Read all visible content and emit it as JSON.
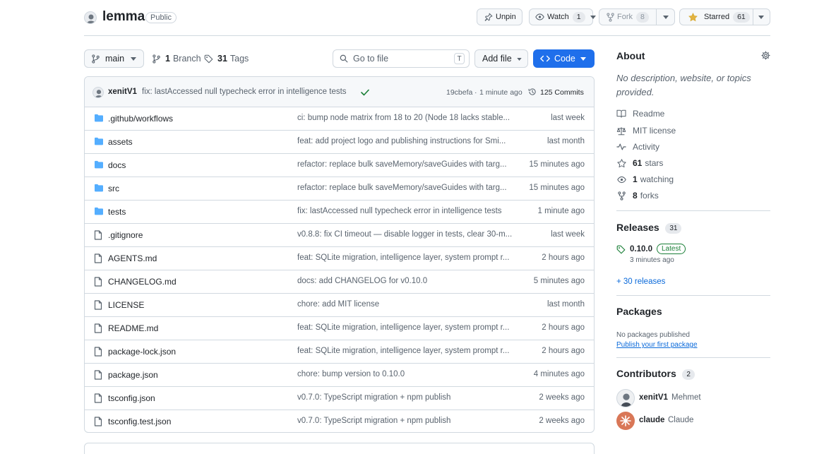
{
  "repo": {
    "name": "lemma",
    "visibility": "Public",
    "unpin_label": "Unpin",
    "watch_label": "Watch",
    "watch_count": "1",
    "fork_label": "Fork",
    "fork_count": "8",
    "star_label": "Starred",
    "star_count": "61"
  },
  "toolbar": {
    "branch": "main",
    "branch_count": "1",
    "branch_label": "Branch",
    "tag_count": "31",
    "tag_label": "Tags",
    "search_placeholder": "Go to file",
    "search_kbd": "T",
    "add_file": "Add file",
    "code": "Code"
  },
  "commit": {
    "author": "xenitV1",
    "message": "fix: lastAccessed null typecheck error in intelligence tests",
    "sha": "19cbefa",
    "sep": "·",
    "time": "1 minute ago",
    "count_label": "125 Commits"
  },
  "files": [
    {
      "type": "dir",
      "name": ".github/workflows",
      "message": "ci: bump node matrix from 18 to 20 (Node 18 lacks stable...",
      "time": "last week"
    },
    {
      "type": "dir",
      "name": "assets",
      "message": "feat: add project logo and publishing instructions for Smi...",
      "time": "last month"
    },
    {
      "type": "dir",
      "name": "docs",
      "message": "refactor: replace bulk saveMemory/saveGuides with targ...",
      "time": "15 minutes ago"
    },
    {
      "type": "dir",
      "name": "src",
      "message": "refactor: replace bulk saveMemory/saveGuides with targ...",
      "time": "15 minutes ago"
    },
    {
      "type": "dir",
      "name": "tests",
      "message": "fix: lastAccessed null typecheck error in intelligence tests",
      "time": "1 minute ago"
    },
    {
      "type": "file",
      "name": ".gitignore",
      "message": "v0.8.8: fix CI timeout — disable logger in tests, clear 30-m...",
      "time": "last week"
    },
    {
      "type": "file",
      "name": "AGENTS.md",
      "message": "feat: SQLite migration, intelligence layer, system prompt r...",
      "time": "2 hours ago"
    },
    {
      "type": "file",
      "name": "CHANGELOG.md",
      "message": "docs: add CHANGELOG for v0.10.0",
      "time": "5 minutes ago"
    },
    {
      "type": "file",
      "name": "LICENSE",
      "message": "chore: add MIT license",
      "time": "last month"
    },
    {
      "type": "file",
      "name": "README.md",
      "message": "feat: SQLite migration, intelligence layer, system prompt r...",
      "time": "2 hours ago"
    },
    {
      "type": "file",
      "name": "package-lock.json",
      "message": "feat: SQLite migration, intelligence layer, system prompt r...",
      "time": "2 hours ago"
    },
    {
      "type": "file",
      "name": "package.json",
      "message": "chore: bump version to 0.10.0",
      "time": "4 minutes ago"
    },
    {
      "type": "file",
      "name": "tsconfig.json",
      "message": "v0.7.0: TypeScript migration + npm publish",
      "time": "2 weeks ago"
    },
    {
      "type": "file",
      "name": "tsconfig.test.json",
      "message": "v0.7.0: TypeScript migration + npm publish",
      "time": "2 weeks ago"
    }
  ],
  "about": {
    "title": "About",
    "description": "No description, website, or topics provided.",
    "readme": "Readme",
    "license": "MIT license",
    "activity": "Activity",
    "stars_count": "61",
    "stars_label": "stars",
    "watching_count": "1",
    "watching_label": "watching",
    "forks_count": "8",
    "forks_label": "forks"
  },
  "releases": {
    "title": "Releases",
    "count": "31",
    "version": "0.10.0",
    "badge": "Latest",
    "time": "3 minutes ago",
    "more": "+ 30 releases"
  },
  "packages": {
    "title": "Packages",
    "empty": "No packages published",
    "publish_link": "Publish your first package"
  },
  "contributors": {
    "title": "Contributors",
    "count": "2",
    "list": [
      {
        "login": "xenitV1",
        "name": "Mehmet"
      },
      {
        "login": "claude",
        "name": "Claude"
      }
    ]
  },
  "colors": {
    "accent": "#0969da",
    "code_button": "#1f6feb",
    "folder": "#54aeff",
    "star": "#e3b341",
    "check": "#1a7f37",
    "claude": "#d97757"
  }
}
